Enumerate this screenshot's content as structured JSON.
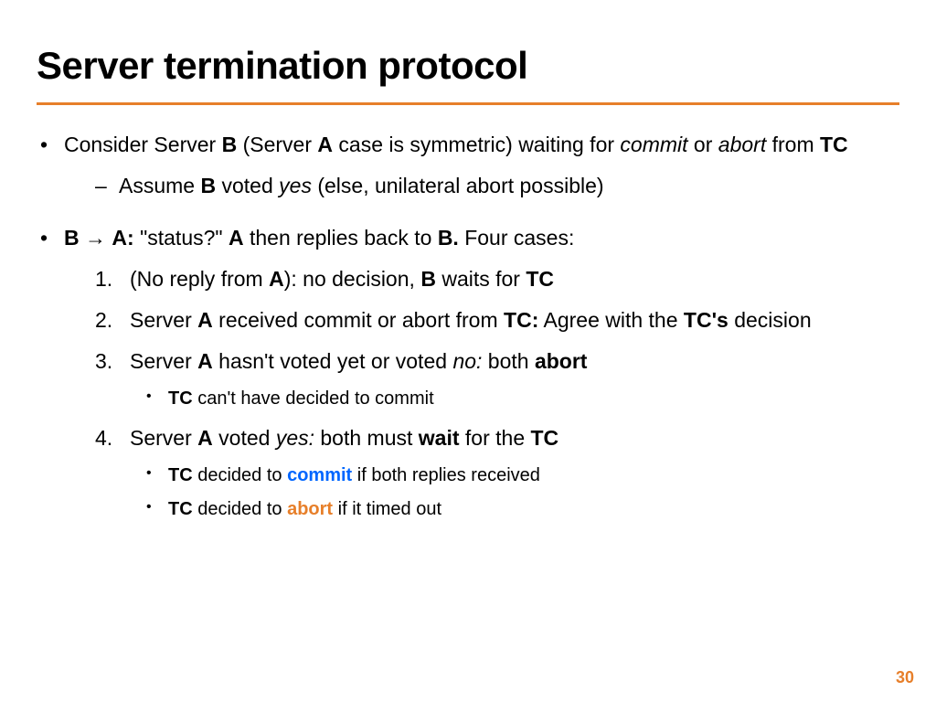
{
  "title": "Server termination protocol",
  "page_number": "30",
  "colors": {
    "accent": "#e77f2a",
    "commit": "#0066ff",
    "abort": "#e77f2a"
  },
  "bullet1": {
    "pre": "Consider Server ",
    "B": "B",
    "mid1": " (Server ",
    "A": "A",
    "mid2": " case is symmetric) waiting for ",
    "commit": "commit",
    "or": " or ",
    "abort": "abort",
    "from": " from ",
    "TC": "TC",
    "sub": {
      "pre": "Assume ",
      "B": "B",
      "mid": " voted ",
      "yes": "yes",
      "post": " (else, unilateral abort possible)"
    }
  },
  "bullet2": {
    "B": "B",
    "arrow": " → ",
    "A": "A:",
    "status": " \"status?\" ",
    "A2": "A",
    "mid": " then replies back to ",
    "B2": "B.",
    "tail": "  Four cases:"
  },
  "case1": {
    "pre": "(No reply from ",
    "A": "A",
    "mid": "): no decision, ",
    "B": "B",
    "wait": " waits for ",
    "TC": "TC"
  },
  "case2": {
    "pre": "Server ",
    "A": "A",
    "mid": " received commit or abort from ",
    "TC": "TC:",
    "agree": " Agree with the ",
    "TCs": "TC's",
    "dec": " decision"
  },
  "case3": {
    "pre": "Server ",
    "A": "A",
    "mid": " hasn't voted yet or voted ",
    "no": "no:",
    "both": " both ",
    "abort": "abort",
    "sub": {
      "TC": "TC",
      "txt": " can't have decided to commit"
    }
  },
  "case4": {
    "pre": "Server ",
    "A": "A",
    "voted": " voted ",
    "yes": "yes:",
    "both": " both must ",
    "wait": "wait",
    "forthe": " for the ",
    "TC": "TC",
    "sub1": {
      "TC": "TC",
      "pre": " decided to ",
      "commit": "commit",
      "post": " if both replies received"
    },
    "sub2": {
      "TC": "TC",
      "pre": " decided to ",
      "abort": "abort",
      "post": " if it timed out"
    }
  }
}
